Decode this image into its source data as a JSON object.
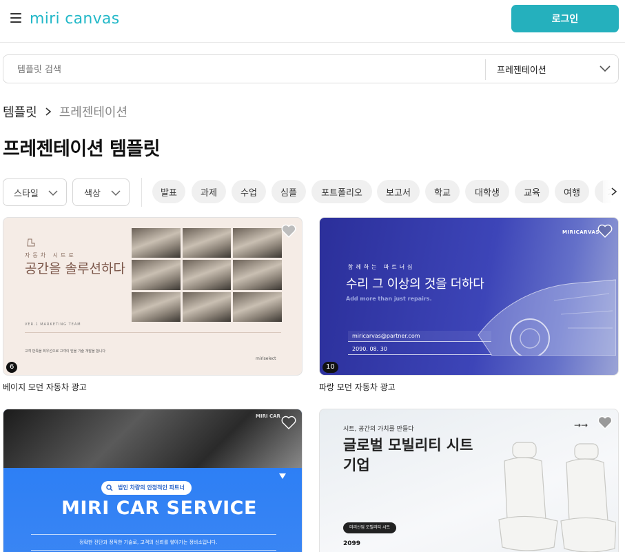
{
  "header": {
    "logo_text": "miri canvas",
    "login_label": "로그인"
  },
  "search": {
    "placeholder": "템플릿 검색",
    "category_selected": "프레젠테이션"
  },
  "breadcrumb": {
    "home": "템플릿",
    "current": "프레젠테이션"
  },
  "page_title": "프레젠테이션 템플릿",
  "filters": {
    "style_label": "스타일",
    "color_label": "색상",
    "chips": [
      "발표",
      "과제",
      "수업",
      "심플",
      "포트폴리오",
      "보고서",
      "학교",
      "대학생",
      "교육",
      "여행",
      "기"
    ]
  },
  "cards": [
    {
      "title": "베이지 모던 자동차 광고",
      "page_count": "6",
      "preview": {
        "sub": "자동차 시트로",
        "headline": "공간을 솔루션하다",
        "footer_small": "VER.1    MARKETING TEAM",
        "footer_text": "고객 만족을 최우선으로 고객이 믿을 기술 개발을 합니다",
        "brand": "miriselect"
      }
    },
    {
      "title": "파랑 모던 자동차 광고",
      "page_count": "10",
      "preview": {
        "brand": "MIRICARVAS",
        "sub": "함께하는 파트너십",
        "headline": "수리 그 이상의 것을 더하다",
        "english": "Add more than just repairs.",
        "email": "miricarvas@partner.com",
        "date": "2090. 08. 30"
      }
    },
    {
      "title": "",
      "page_count": "",
      "preview": {
        "brand": "MIRI CAR",
        "pill": "법인 차량의 안정적인 파트너",
        "headline": "MIRI CAR SERVICE",
        "desc": "정확한 진단과 정직한 기술로, 고객의 신뢰를 쌓아가는 정비소입니다."
      }
    },
    {
      "title": "",
      "page_count": "",
      "preview": {
        "sub": "시트, 공간의 가치를 만들다",
        "headline": "글로벌 모빌리티 시트 기업",
        "tag": "미리산업 모빌리티 시트",
        "year": "2099",
        "arrows": "→→"
      }
    }
  ],
  "colors": {
    "brand": "#25b0bd",
    "chip_bg": "#f0f0f0"
  }
}
